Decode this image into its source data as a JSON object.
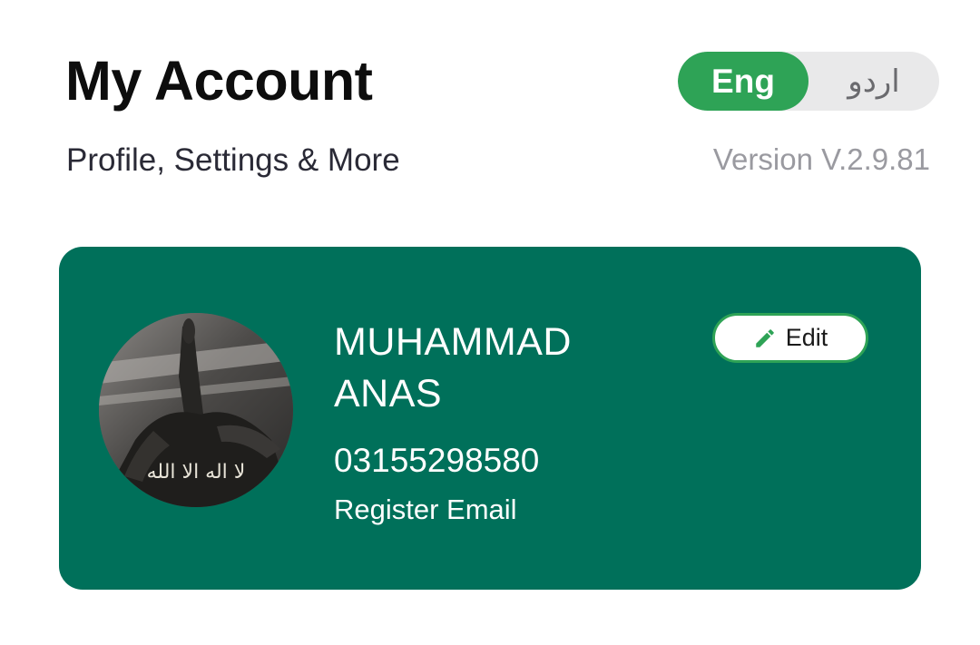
{
  "header": {
    "title": "My Account",
    "subtitle": "Profile, Settings & More",
    "version": "Version V.2.9.81"
  },
  "language_toggle": {
    "options": [
      {
        "label": "Eng",
        "selected": true
      },
      {
        "label": "اردو",
        "selected": false
      }
    ]
  },
  "profile_card": {
    "name": "MUHAMMAD ANAS",
    "phone": "03155298580",
    "email_action": "Register Email",
    "edit_label": "Edit",
    "edit_icon": "pencil-icon",
    "avatar_caption": "لا اله الا الله"
  },
  "colors": {
    "accent_green": "#2ea356",
    "card_background": "#00705a",
    "toggle_background": "#e9e9ea",
    "version_text": "#9a9aa0"
  }
}
